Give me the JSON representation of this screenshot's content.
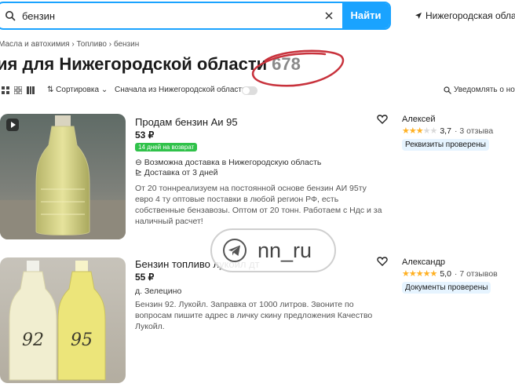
{
  "search": {
    "query": "бензин",
    "button_label": "Найти"
  },
  "region": {
    "label": "Нижегородская област"
  },
  "breadcrumb": "Масла и автохимия  ›  Топливо  ›  бензин",
  "title": {
    "text": "ия для Нижегородской области",
    "count": "678"
  },
  "toolbar": {
    "sort_label": "Сортировка",
    "near_label": "Сначала из Нижегородской области",
    "notify_label": "Уведомлять о нов"
  },
  "listings": [
    {
      "title": "Продам бензин Аи 95",
      "price": "53 ₽",
      "badge": "14 дней на возврат",
      "delivery_region": "Возможна доставка в Нижегородскую область",
      "delivery_time": "Доставка от 3 дней",
      "description": "От 20 тоннреализуем на постоянной основе бензин АИ 95ту евро 4 ту оптовые поставки в любой регион РФ, есть собственные бензавозы. Оптом от 20 тонн. Работаем с Ндс и за наличный расчет!",
      "seller": "Алексей",
      "rating": "3,7",
      "rating_value": 3.7,
      "reviews": "· 3 отзыва",
      "verified": "Реквизиты проверены"
    },
    {
      "title": "Бензин топливо лукоил дт",
      "price": "55 ₽",
      "location": "д. Зелецино",
      "description": "Бензин 92. Лукойл. Заправка от 1000 литров. Звоните по вопросам пишите адрес в личку скину предложения Качество Лукойл.",
      "seller": "Александр",
      "rating": "5,0",
      "rating_value": 5.0,
      "reviews": "· 7 отзывов",
      "verified": "Документы проверены",
      "bottle_labels": [
        "92",
        "95"
      ]
    }
  ],
  "watermark": {
    "text": "nn_ru"
  },
  "colors": {
    "accent": "#1aa3ff",
    "badge_green": "#30c24a",
    "annotation_red": "#c8323c",
    "star": "#ffb021"
  }
}
